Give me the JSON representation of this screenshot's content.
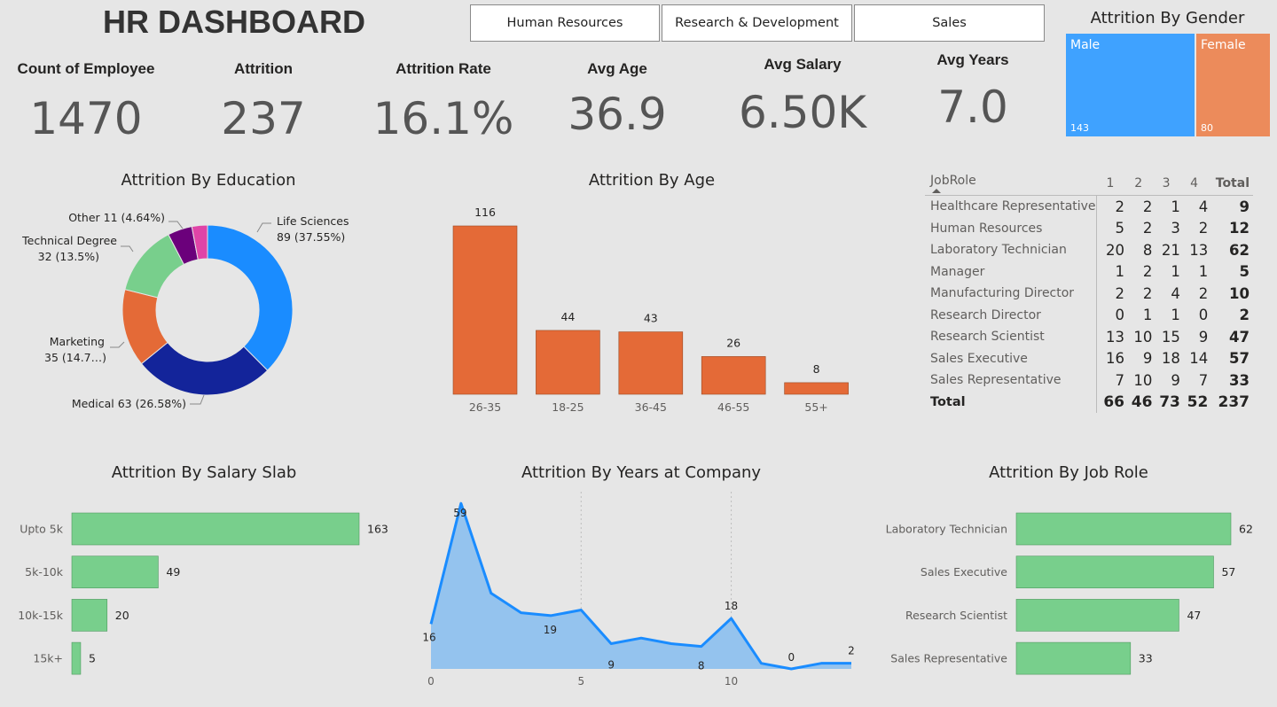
{
  "header": {
    "title": "HR DASHBOARD"
  },
  "slicer": {
    "options": [
      "Human Resources",
      "Research & Development",
      "Sales"
    ]
  },
  "kpis": [
    {
      "label": "Count of Employee",
      "value": "1470"
    },
    {
      "label": "Attrition",
      "value": "237"
    },
    {
      "label": "Attrition Rate",
      "value": "16.1%"
    },
    {
      "label": "Avg Age",
      "value": "36.9"
    },
    {
      "label": "Avg Salary",
      "value": "6.50K"
    },
    {
      "label": "Avg Years",
      "value": "7.0"
    }
  ],
  "colors": {
    "male": "#3fa2ff",
    "female": "#ec8b5b",
    "orange_bar": "#e46a37",
    "green_bar": "#78cf8c",
    "line": "#1a8cff",
    "area": "#94c3ee",
    "life_sciences": "#1a8cff",
    "medical": "#13249a",
    "marketing": "#e46a37",
    "technical": "#78cf8c",
    "other": "#6b007b",
    "extra": "#e044a7"
  },
  "chart_data": [
    {
      "type": "treemap",
      "title": "Attrition By Gender",
      "categories": [
        "Male",
        "Female"
      ],
      "values": [
        143,
        80
      ],
      "value_labels": [
        "143",
        "80"
      ]
    },
    {
      "type": "donut",
      "title": "Attrition By Education",
      "categories": [
        "Life Sciences",
        "Medical",
        "Marketing",
        "Technical Degree",
        "Other",
        ""
      ],
      "values": [
        89,
        63,
        35,
        32,
        11,
        7
      ],
      "labels": [
        "89 (37.55%)",
        "Medical 63 (26.58%)",
        "35 (14.7…)",
        "32 (13.5%)",
        "Other 11 (4.64%)",
        ""
      ]
    },
    {
      "type": "bar",
      "title": "Attrition By Age",
      "categories": [
        "26-35",
        "18-25",
        "36-45",
        "46-55",
        "55+"
      ],
      "values": [
        116,
        44,
        43,
        26,
        8
      ],
      "value_labels": [
        "116",
        "44",
        "43",
        "26",
        "8"
      ]
    },
    {
      "type": "table",
      "title": "",
      "columns": [
        "JobRole",
        "1",
        "2",
        "3",
        "4",
        "Total"
      ],
      "rows": [
        [
          "Healthcare Representative",
          "2",
          "2",
          "1",
          "4",
          "9"
        ],
        [
          "Human Resources",
          "5",
          "2",
          "3",
          "2",
          "12"
        ],
        [
          "Laboratory Technician",
          "20",
          "8",
          "21",
          "13",
          "62"
        ],
        [
          "Manager",
          "1",
          "2",
          "1",
          "1",
          "5"
        ],
        [
          "Manufacturing Director",
          "2",
          "2",
          "4",
          "2",
          "10"
        ],
        [
          "Research Director",
          "0",
          "1",
          "1",
          "0",
          "2"
        ],
        [
          "Research Scientist",
          "13",
          "10",
          "15",
          "9",
          "47"
        ],
        [
          "Sales Executive",
          "16",
          "9",
          "18",
          "14",
          "57"
        ],
        [
          "Sales Representative",
          "7",
          "10",
          "9",
          "7",
          "33"
        ]
      ],
      "total_row": [
        "Total",
        "66",
        "46",
        "73",
        "52",
        "237"
      ]
    },
    {
      "type": "bar",
      "orientation": "horizontal",
      "title": "Attrition By Salary Slab",
      "categories": [
        "Upto 5k",
        "5k-10k",
        "10k-15k",
        "15k+"
      ],
      "values": [
        163,
        49,
        20,
        5
      ],
      "value_labels": [
        "163",
        "49",
        "20",
        "5"
      ]
    },
    {
      "type": "area",
      "title": "Attrition By Years at Company",
      "x": [
        0,
        1,
        2,
        3,
        4,
        5,
        6,
        7,
        8,
        9,
        10,
        11,
        12,
        13,
        14
      ],
      "y": [
        16,
        59,
        27,
        20,
        19,
        21,
        9,
        11,
        9,
        8,
        18,
        2,
        0,
        2,
        2
      ],
      "point_labels": [
        {
          "x": 0,
          "label": "16"
        },
        {
          "x": 1,
          "label": "59"
        },
        {
          "x": 4,
          "label": "19"
        },
        {
          "x": 6,
          "label": "9"
        },
        {
          "x": 9,
          "label": "8"
        },
        {
          "x": 10,
          "label": "18"
        },
        {
          "x": 12,
          "label": "0"
        },
        {
          "x": 14,
          "label": "2"
        }
      ],
      "xticks": [
        "0",
        "5",
        "10"
      ],
      "xlim": [
        0,
        14
      ],
      "ylim": [
        0,
        60
      ]
    },
    {
      "type": "bar",
      "orientation": "horizontal",
      "title": "Attrition By Job Role",
      "categories": [
        "Laboratory Technician",
        "Sales Executive",
        "Research Scientist",
        "Sales Representative"
      ],
      "values": [
        62,
        57,
        47,
        33
      ],
      "value_labels": [
        "62",
        "57",
        "47",
        "33"
      ]
    }
  ]
}
